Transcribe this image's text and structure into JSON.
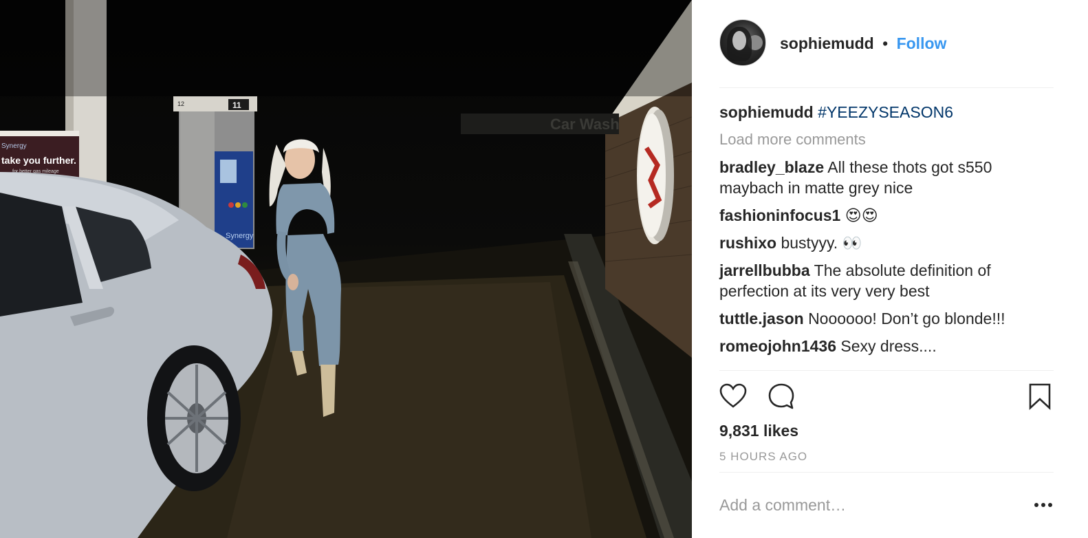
{
  "photo": {
    "alt_icon": "photo-gas-station-night",
    "sign_text": "take you further.",
    "sign_subtext": "for better gas mileage",
    "sign_brand": "Synergy",
    "pump_brand": "Synergy",
    "pump_number": "11",
    "pump_number_left": "12",
    "carwash_text": "Car Wash"
  },
  "post": {
    "username": "sophiemudd",
    "separator": "•",
    "follow_label": "Follow",
    "caption": {
      "user": "sophiemudd",
      "hashtag": "#YEEZYSEASON6"
    },
    "load_more_label": "Load more comments",
    "comments": [
      {
        "user": "bradley_blaze",
        "text": "All these thots got s550 maybach in matte grey nice"
      },
      {
        "user": "fashioninfocus1",
        "text": "😍😍"
      },
      {
        "user": "rushixo",
        "text": "bustyyy. 👀"
      },
      {
        "user": "jarrellbubba",
        "text": "The absolute definition of perfection at its very very best"
      },
      {
        "user": "tuttle.jason",
        "text": "Noooooo! Don’t go blonde!!!"
      },
      {
        "user": "romeojohn1436",
        "text": "Sexy dress...."
      }
    ],
    "likes": "9,831 likes",
    "time_ago": "5 HOURS AGO",
    "comment_placeholder": "Add a comment…",
    "icons": {
      "like": "heart-icon",
      "comment": "comment-icon",
      "save": "bookmark-icon",
      "more": "more-options-icon"
    },
    "colors": {
      "link": "#3897f0",
      "hashtag": "#003569",
      "muted": "#999999",
      "text": "#262626"
    }
  }
}
